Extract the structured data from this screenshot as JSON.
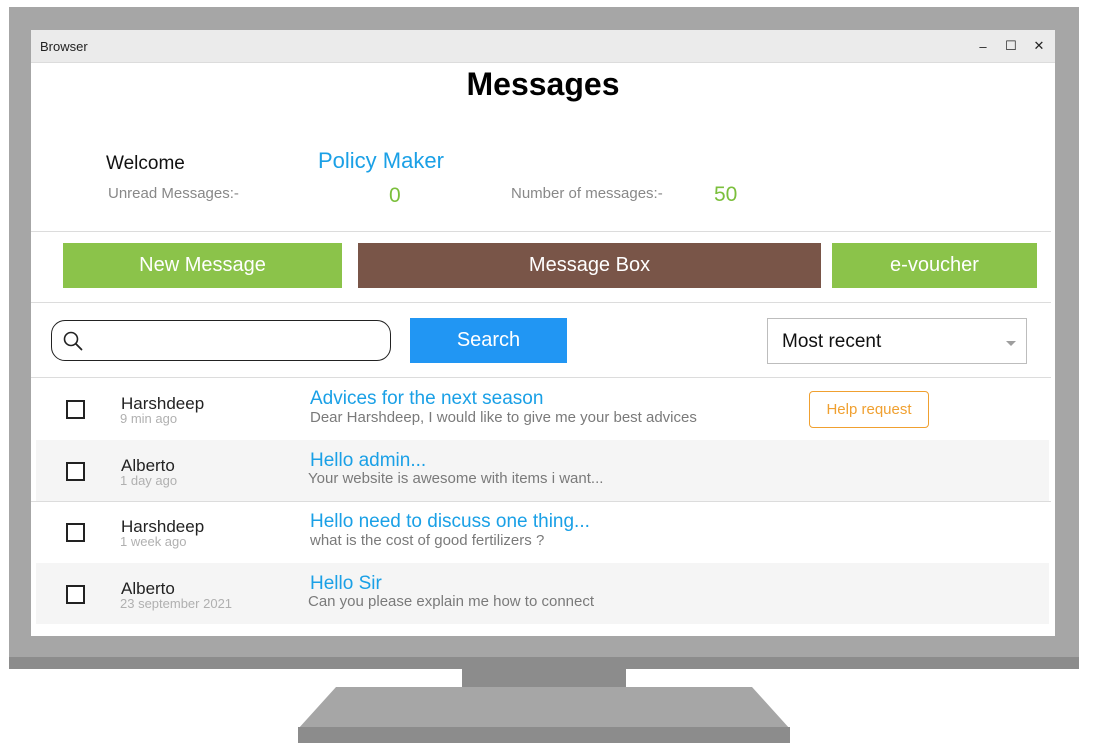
{
  "window": {
    "title": "Browser",
    "controls": {
      "minimize": "–",
      "maximize": "☐",
      "close": "✕"
    }
  },
  "page": {
    "title": "Messages",
    "welcome_label": "Welcome",
    "username": "Policy Maker",
    "unread_label": "Unread Messages:-",
    "unread_count": "0",
    "total_label": "Number of messages:-",
    "total_count": "50"
  },
  "nav": {
    "new_message": "New Message",
    "message_box": "Message Box",
    "voucher": "e-voucher"
  },
  "search": {
    "value": "",
    "placeholder": "",
    "button_label": "Search"
  },
  "sort": {
    "selected": "Most recent"
  },
  "messages": [
    {
      "sender": "Harshdeep",
      "time": "9 min ago",
      "subject": "Advices for the next season",
      "preview": "Dear Harshdeep, I would like to give me your best advices",
      "action": "Help request"
    },
    {
      "sender": "Alberto",
      "time": "1 day ago",
      "subject": "Hello admin...",
      "preview": "Your website is awesome with items i want..."
    },
    {
      "sender": "Harshdeep",
      "time": "1 week ago",
      "subject": "Hello need to discuss one thing...",
      "preview": "what is the cost of good fertilizers ?"
    },
    {
      "sender": "Alberto",
      "time": "23 september 2021",
      "subject": "Hello Sir",
      "preview": "Can you please explain me how to connect"
    }
  ],
  "colors": {
    "accent_blue": "#2196f3",
    "link_blue": "#1aa0e6",
    "green": "#8bc34a",
    "brown": "#795548",
    "orange": "#f0a030"
  }
}
